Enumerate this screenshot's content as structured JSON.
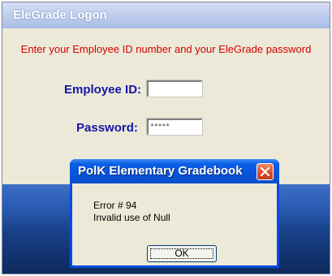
{
  "logon": {
    "title": "EleGrade Logon",
    "instruction": "Enter your Employee ID number and your EleGrade password",
    "employee_id_label": "Employee ID:",
    "employee_id_value": "",
    "password_label": "Password:",
    "password_value": "*****"
  },
  "dialog": {
    "title": "PolK Elementary Gradebook",
    "error_code": "Error # 94",
    "error_message": "Invalid use of Null",
    "ok_label": "OK"
  },
  "colors": {
    "instruction_text": "#d40000",
    "label_text": "#1515a8",
    "dialog_titlebar": "#0754d9",
    "close_button": "#d94a2a"
  }
}
